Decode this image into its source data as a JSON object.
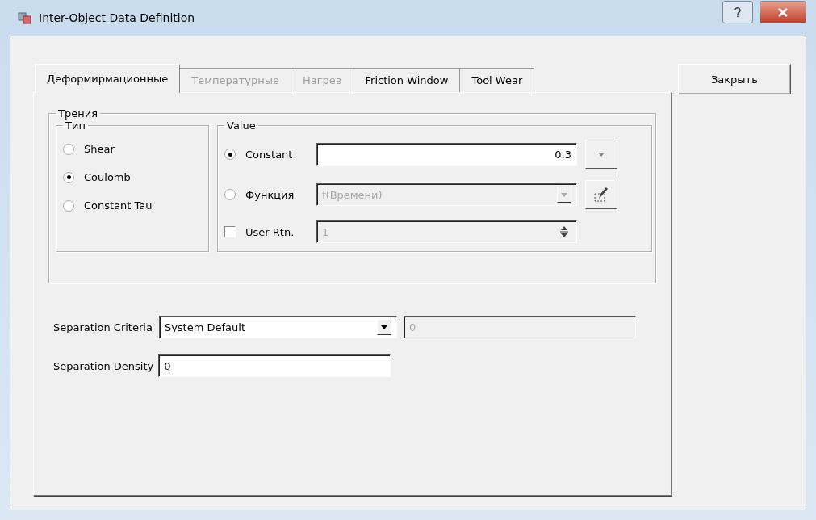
{
  "window": {
    "title": "Inter-Object Data Definition"
  },
  "tabs": [
    {
      "label": "Деформирмационные",
      "selected": true,
      "disabled": false
    },
    {
      "label": "Температурные",
      "selected": false,
      "disabled": true
    },
    {
      "label": "Нагрев",
      "selected": false,
      "disabled": true
    },
    {
      "label": "Friction Window",
      "selected": false,
      "disabled": false
    },
    {
      "label": "Tool Wear",
      "selected": false,
      "disabled": false
    }
  ],
  "close_button": "Закрыть",
  "friction": {
    "title": "Трения",
    "type_group": {
      "title": "Тип",
      "options": [
        {
          "label": "Shear",
          "selected": false
        },
        {
          "label": "Coulomb",
          "selected": true
        },
        {
          "label": "Constant Tau",
          "selected": false
        }
      ]
    },
    "value_group": {
      "title": "Value",
      "constant": {
        "label": "Constant",
        "selected": true,
        "value": "0.3"
      },
      "function": {
        "label": "Функция",
        "selected": false,
        "value": "f(Времени)",
        "disabled": true
      },
      "user_rtn": {
        "label": "User Rtn.",
        "checked": false,
        "value": "1",
        "disabled": true
      }
    }
  },
  "separation_criteria": {
    "label": "Separation Criteria",
    "value": "System Default",
    "extra_value": "0"
  },
  "separation_density": {
    "label": "Separation Density",
    "value": "0"
  }
}
